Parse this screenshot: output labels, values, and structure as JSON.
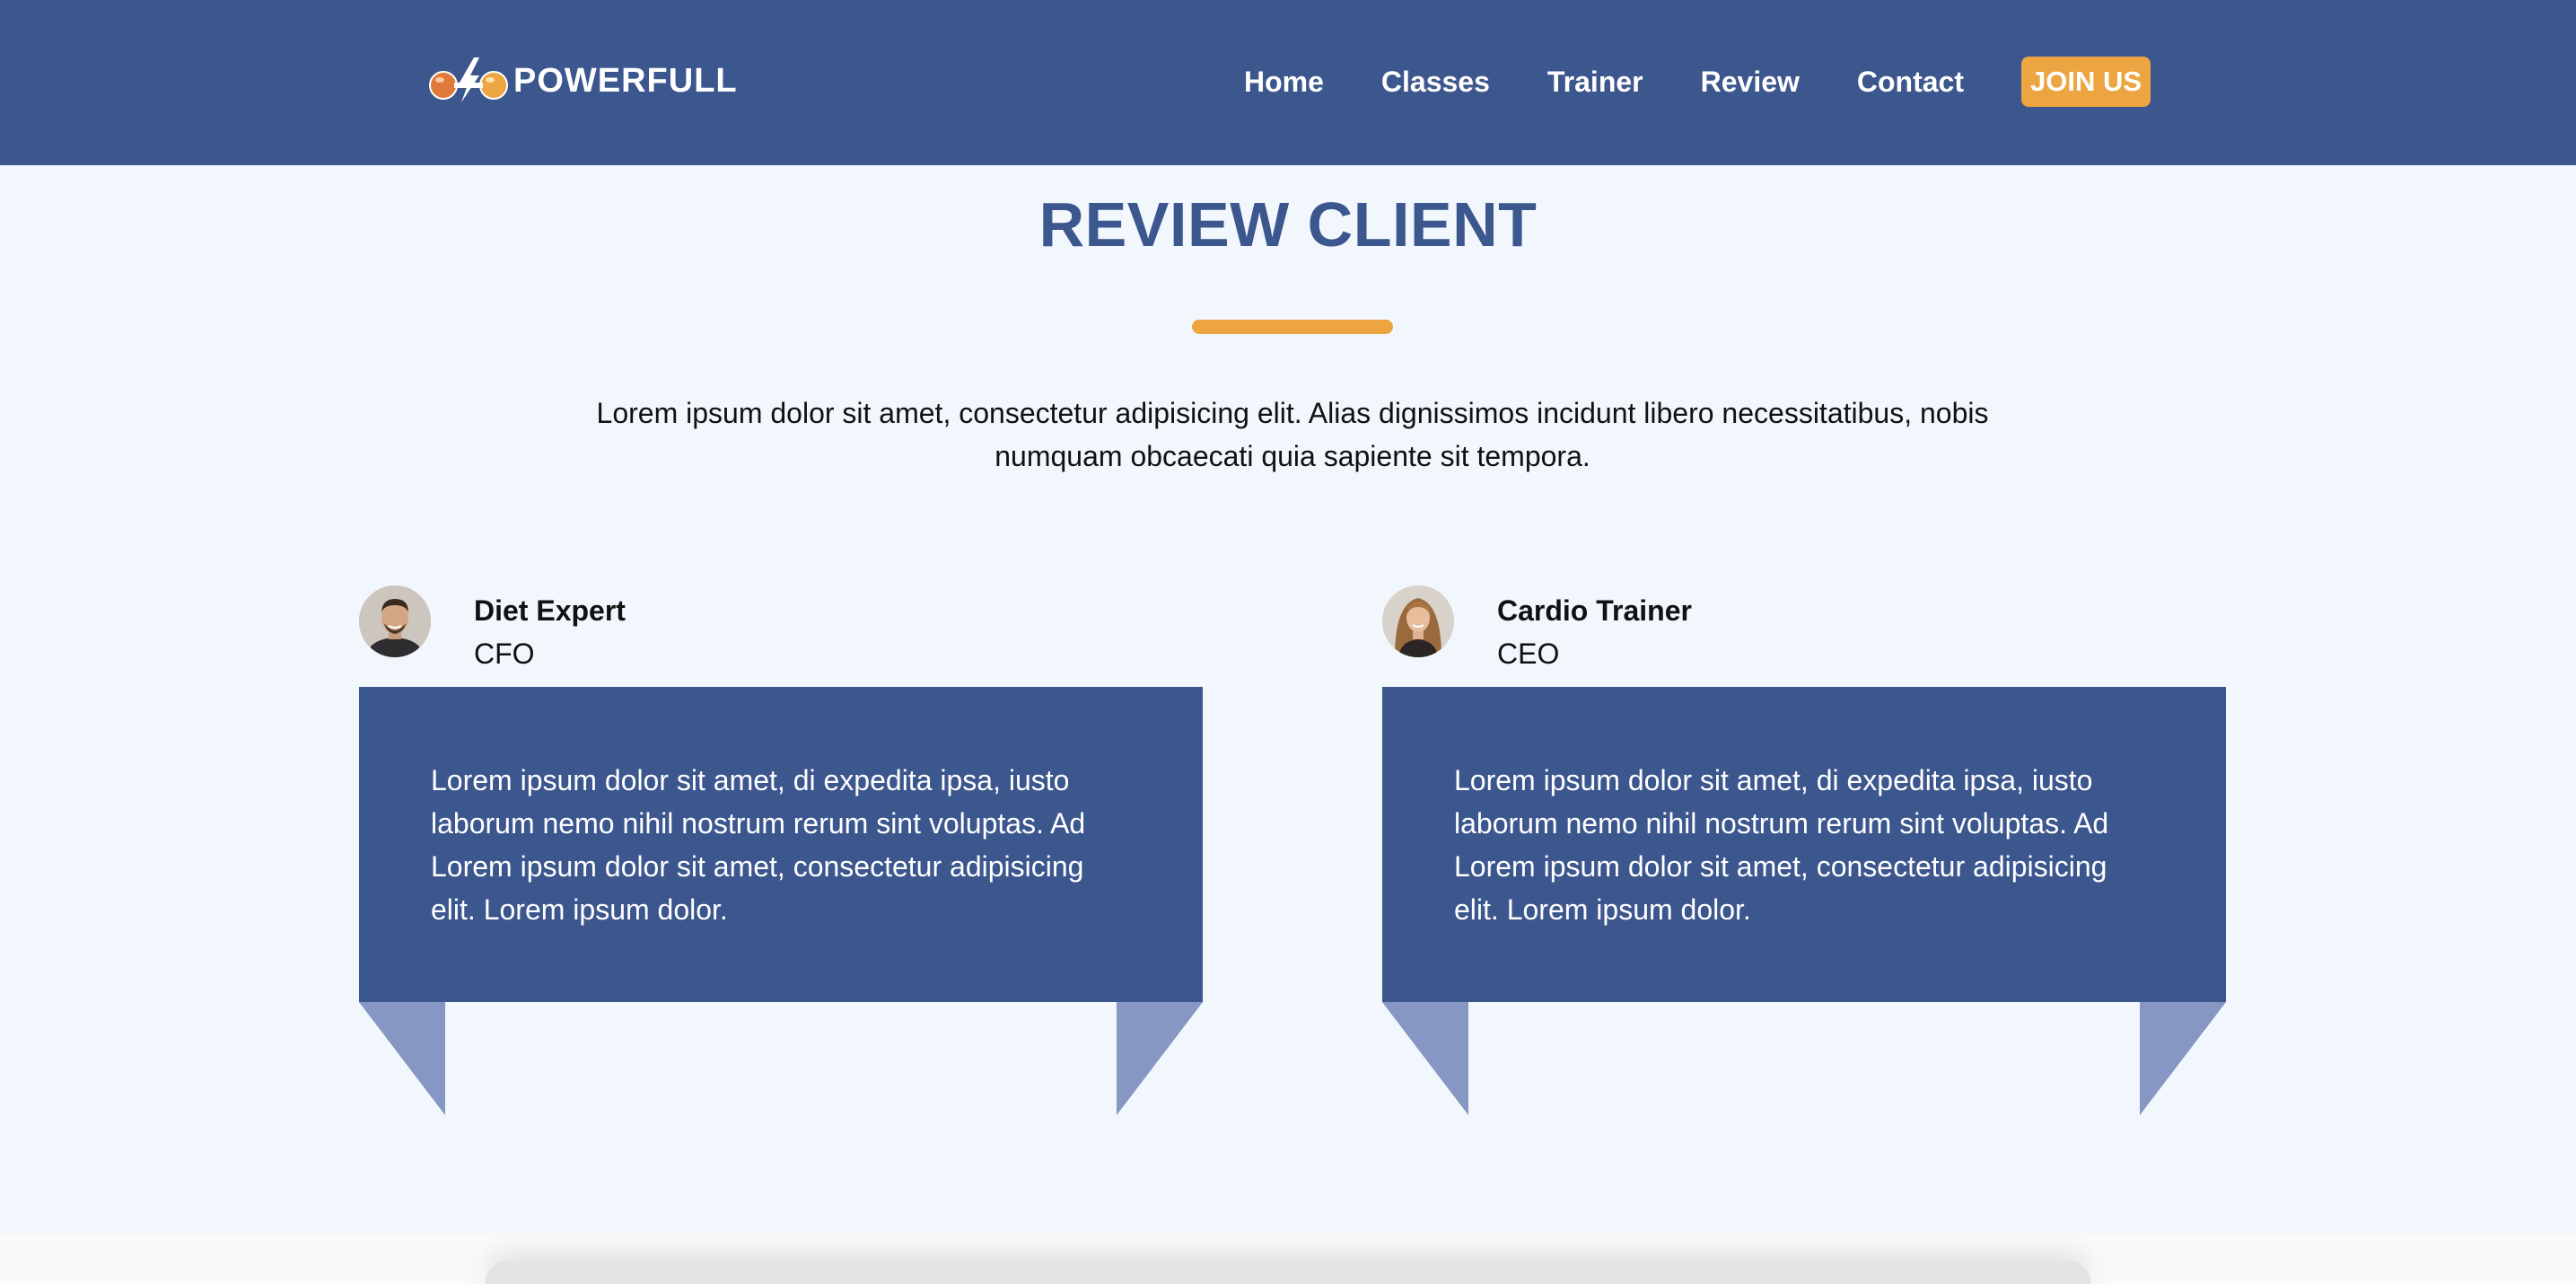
{
  "brand": {
    "name": "POWERFULL",
    "logo_icon": "dumbbell-lightning-icon",
    "color_primary": "#3c568e",
    "color_accent": "#eca540"
  },
  "nav": {
    "links": [
      "Home",
      "Classes",
      "Trainer",
      "Review",
      "Contact"
    ],
    "cta": "JOIN US"
  },
  "section": {
    "title": "REVIEW CLIENT",
    "description": "Lorem ipsum dolor sit amet, consectetur adipisicing elit. Alias dignissimos incidunt libero necessitatibus, nobis numquam obcaecati quia sapiente sit tempora."
  },
  "reviews": [
    {
      "name": "Diet Expert",
      "role": "CFO",
      "avatar": "man-avatar",
      "text": "Lorem ipsum dolor sit amet, di expedita ipsa, iusto laborum nemo nihil nostrum rerum sint voluptas. Ad Lorem ipsum dolor sit amet, consectetur adipisicing elit. Lorem ipsum dolor."
    },
    {
      "name": "Cardio Trainer",
      "role": "CEO",
      "avatar": "woman-avatar",
      "text": "Lorem ipsum dolor sit amet, di expedita ipsa, iusto laborum nemo nihil nostrum rerum sint voluptas. Ad Lorem ipsum dolor sit amet, consectetur adipisicing elit. Lorem ipsum dolor."
    }
  ]
}
